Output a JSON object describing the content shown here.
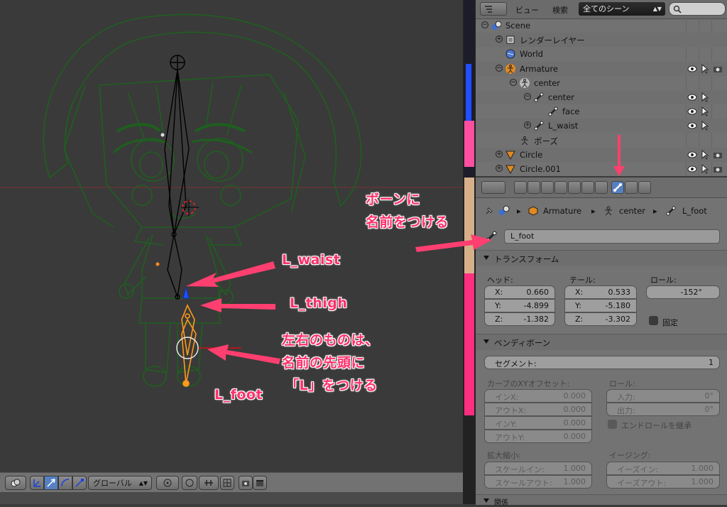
{
  "outliner": {
    "view_label": "ビュー",
    "search_label": "検索",
    "scene_filter": "全てのシーン",
    "items": [
      {
        "label": "Scene"
      },
      {
        "label": "レンダーレイヤー"
      },
      {
        "label": "World"
      },
      {
        "label": "Armature"
      },
      {
        "label": "center"
      },
      {
        "label": "center"
      },
      {
        "label": "face"
      },
      {
        "label": "L_waist"
      },
      {
        "label": "ポーズ"
      },
      {
        "label": "Circle"
      },
      {
        "label": "Circle.001"
      }
    ]
  },
  "properties": {
    "breadcrumb": [
      "Armature",
      "center",
      "L_foot"
    ],
    "bone_name": "L_foot",
    "transform": {
      "title": "トランスフォーム",
      "head_label": "ヘッド:",
      "tail_label": "テール:",
      "roll_label": "ロール:",
      "head": {
        "x": "0.660",
        "y": "-4.899",
        "z": "-1.382"
      },
      "tail": {
        "x": "0.533",
        "y": "-5.180",
        "z": "-3.302"
      },
      "roll": "-152°",
      "lock_label": "固定",
      "x_key": "X:",
      "y_key": "Y:",
      "z_key": "Z:"
    },
    "bendy": {
      "title": "ベンディボーン",
      "segments_label": "セグメント:",
      "segments_value": "1",
      "curve_offset_label": "カーブのXYオフセット:",
      "roll_label": "ロール:",
      "in_x_label": "インX:",
      "in_x": "0.000",
      "out_x_label": "アウトX:",
      "out_x": "0.000",
      "in_y_label": "インY:",
      "in_y": "0.000",
      "out_y_label": "アウトY:",
      "out_y": "0.000",
      "roll_in_label": "入力:",
      "roll_in": "0°",
      "roll_out_label": "出力:",
      "roll_out": "0°",
      "inherit_end_roll": "エンドロールを継承",
      "scale_label": "拡大縮小:",
      "scale_in_label": "スケールイン:",
      "scale_in": "1.000",
      "scale_out_label": "スケールアウト:",
      "scale_out": "1.000",
      "easing_label": "イージング:",
      "ease_in_label": "イーズイン:",
      "ease_in": "1.000",
      "ease_out_label": "イーズアウト:",
      "ease_out": "1.000",
      "next_section": "関係"
    }
  },
  "viewport_toolbar": {
    "transform_orientation": "グローバル"
  },
  "annotations": {
    "bone_name_note_line1": "ボーンに",
    "bone_name_note_line2": "名前をつける",
    "l_waist": "L_waist",
    "l_thigh": "L_thigh",
    "lr_note_line1": "左右のものは、",
    "lr_note_line2": "名前の先頭に",
    "lr_note_line3": "「L」をつける",
    "l_foot": "L_foot"
  },
  "colors": {
    "annotation": "#ff2f6a",
    "selected_bone": "#ff9a1a",
    "mesh_wire": "#1d5a1d"
  }
}
